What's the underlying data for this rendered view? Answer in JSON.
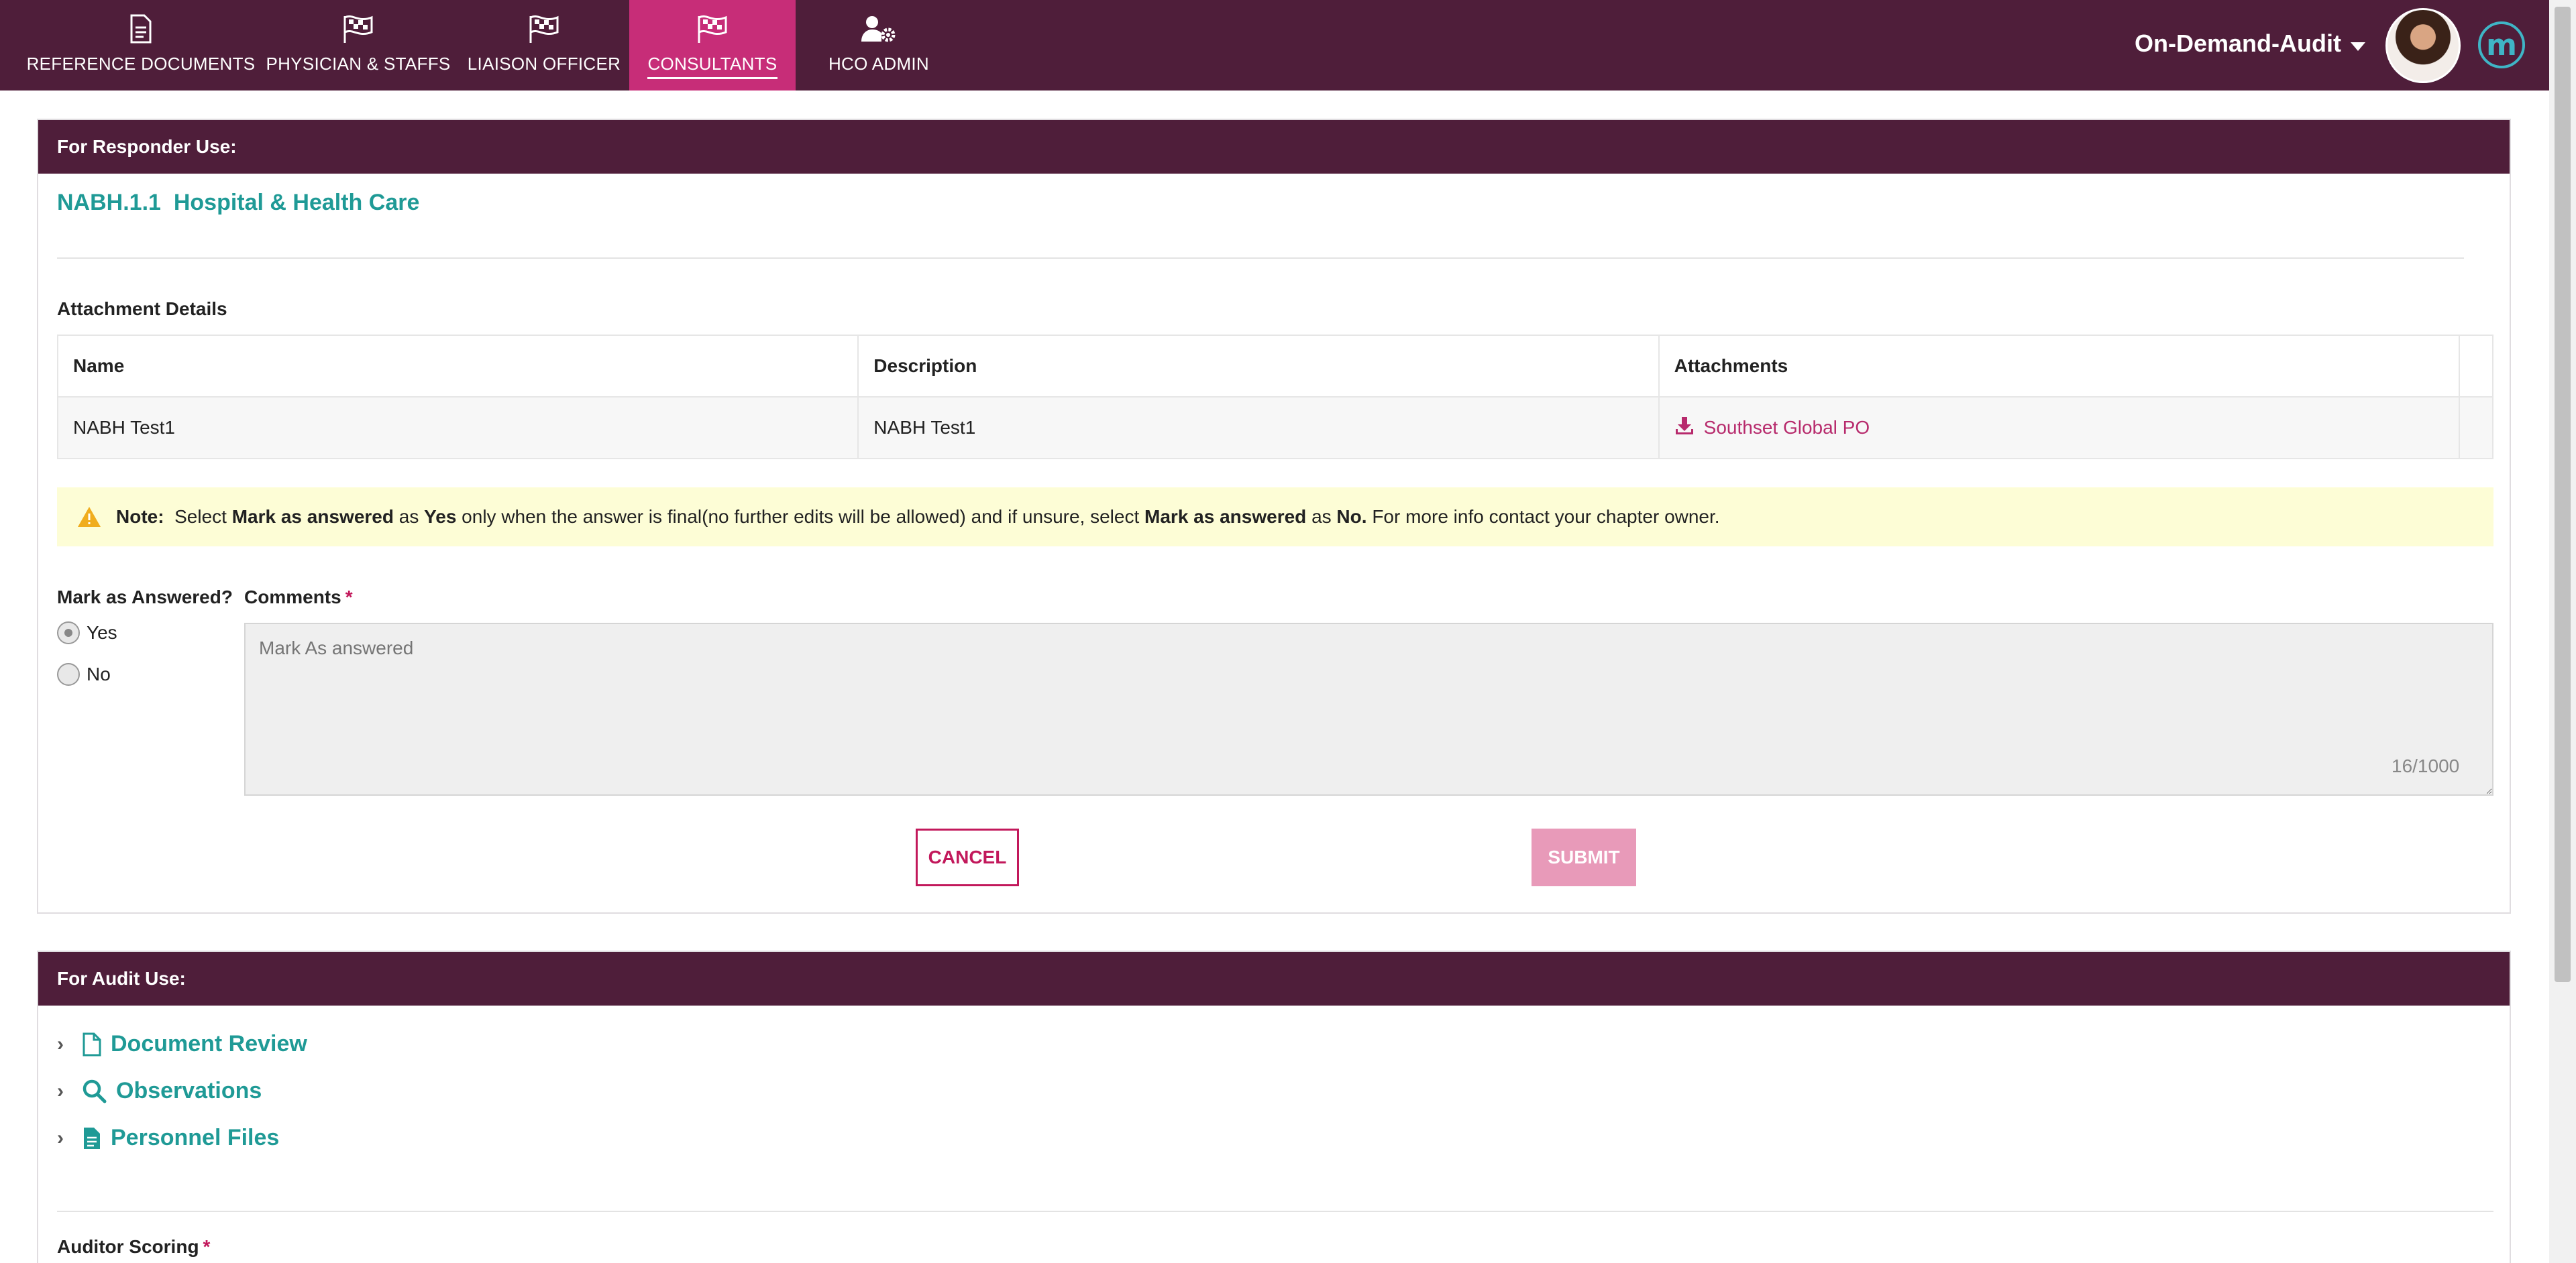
{
  "nav": {
    "items": [
      {
        "label": "REFERENCE DOCUMENTS",
        "icon": "document-icon"
      },
      {
        "label": "PHYSICIAN & STAFFS",
        "icon": "flag-icon"
      },
      {
        "label": "LIAISON OFFICER",
        "icon": "flag-icon"
      },
      {
        "label": "CONSULTANTS",
        "icon": "flag-icon",
        "active": true
      },
      {
        "label": "HCO ADMIN",
        "icon": "user-gear-icon"
      }
    ],
    "audit_selector": "On-Demand-Audit",
    "logo_letter": "m"
  },
  "responder": {
    "header": "For Responder Use:",
    "standard_code": "NABH.1.1",
    "standard_title": "Hospital & Health Care",
    "attachment_details_label": "Attachment Details",
    "table": {
      "columns": [
        "Name",
        "Description",
        "Attachments"
      ],
      "rows": [
        {
          "name": "NABH Test1",
          "description": "NABH Test1",
          "attachment": "Southset Global PO"
        }
      ]
    },
    "note": {
      "label": "Note:",
      "t1": "Select",
      "b1": "Mark as answered",
      "t2": "as",
      "b2": "Yes",
      "t3": "only when the answer is final(no further edits will be allowed) and if unsure, select",
      "b3": "Mark as answered",
      "t4": "as",
      "b4": "No.",
      "t5": "For more info contact your chapter owner."
    },
    "mark_answered_label": "Mark as Answered?",
    "options": {
      "yes": "Yes",
      "no": "No"
    },
    "selected": "Yes",
    "comments_label": "Comments",
    "required_mark": "*",
    "comments_placeholder": "Mark As answered",
    "counter": "16/1000",
    "cancel_label": "CANCEL",
    "submit_label": "SUBMIT"
  },
  "audit": {
    "header": "For Audit Use:",
    "sections": [
      "Document Review",
      "Observations",
      "Personnel Files"
    ],
    "scoring_label": "Auditor Scoring"
  },
  "colors": {
    "nav_bg": "#4f1e3a",
    "nav_active": "#c72d78",
    "teal": "#1f9a96",
    "accent": "#c2185b",
    "note_bg": "#fdfdd6"
  }
}
